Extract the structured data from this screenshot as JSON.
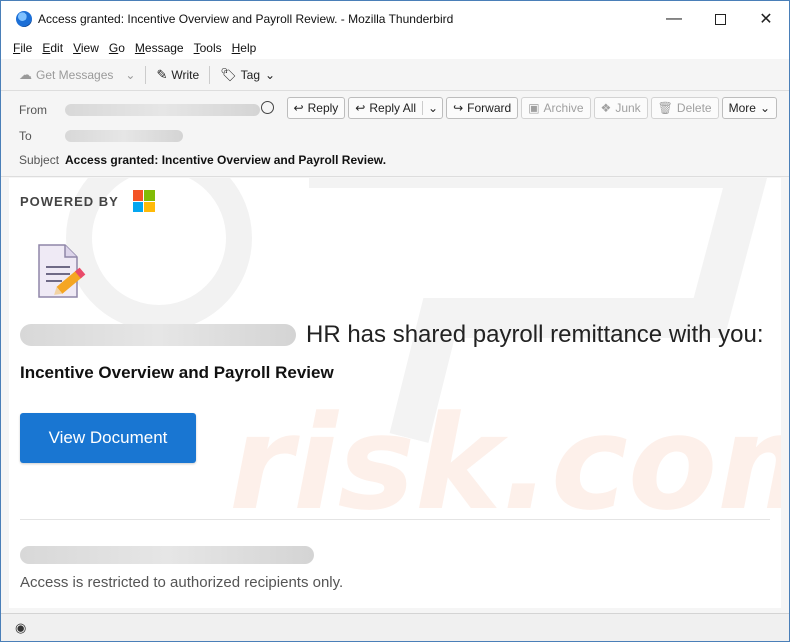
{
  "window": {
    "title": "Access granted: Incentive Overview and Payroll Review. - Mozilla Thunderbird",
    "icon": "thunderbird-icon",
    "controls": [
      "minimize-icon",
      "maximize-icon",
      "close-icon"
    ]
  },
  "menubar": {
    "items": [
      {
        "label": "File",
        "accel": "F",
        "rest": "ile"
      },
      {
        "label": "Edit",
        "accel": "E",
        "rest": "dit"
      },
      {
        "label": "View",
        "accel": "V",
        "rest": "iew"
      },
      {
        "label": "Go",
        "accel": "G",
        "rest": "o"
      },
      {
        "label": "Message",
        "accel": "M",
        "rest": "essage"
      },
      {
        "label": "Tools",
        "accel": "T",
        "rest": "ools"
      },
      {
        "label": "Help",
        "accel": "H",
        "rest": "elp"
      }
    ]
  },
  "toolbar": {
    "get_messages": "Get Messages",
    "write": "Write",
    "tag": "Tag"
  },
  "header": {
    "from_label": "From",
    "to_label": "To",
    "subject_label": "Subject",
    "subject": "Access granted: Incentive Overview and Payroll Review.",
    "buttons": {
      "reply": "Reply",
      "reply_all": "Reply All",
      "forward": "Forward",
      "archive": "Archive",
      "junk": "Junk",
      "delete": "Delete",
      "more": "More"
    }
  },
  "message": {
    "powered_by": "POWERED BY",
    "shared_text": "HR has shared payroll remittance with you:",
    "document_title": "Incentive Overview and Payroll Review",
    "view_button": "View Document",
    "footer_note": "Access is restricted to authorized recipients only.",
    "ms_colors": [
      "#f35325",
      "#81bc06",
      "#05a6f0",
      "#ffba08"
    ],
    "accent": "#1976d2"
  }
}
